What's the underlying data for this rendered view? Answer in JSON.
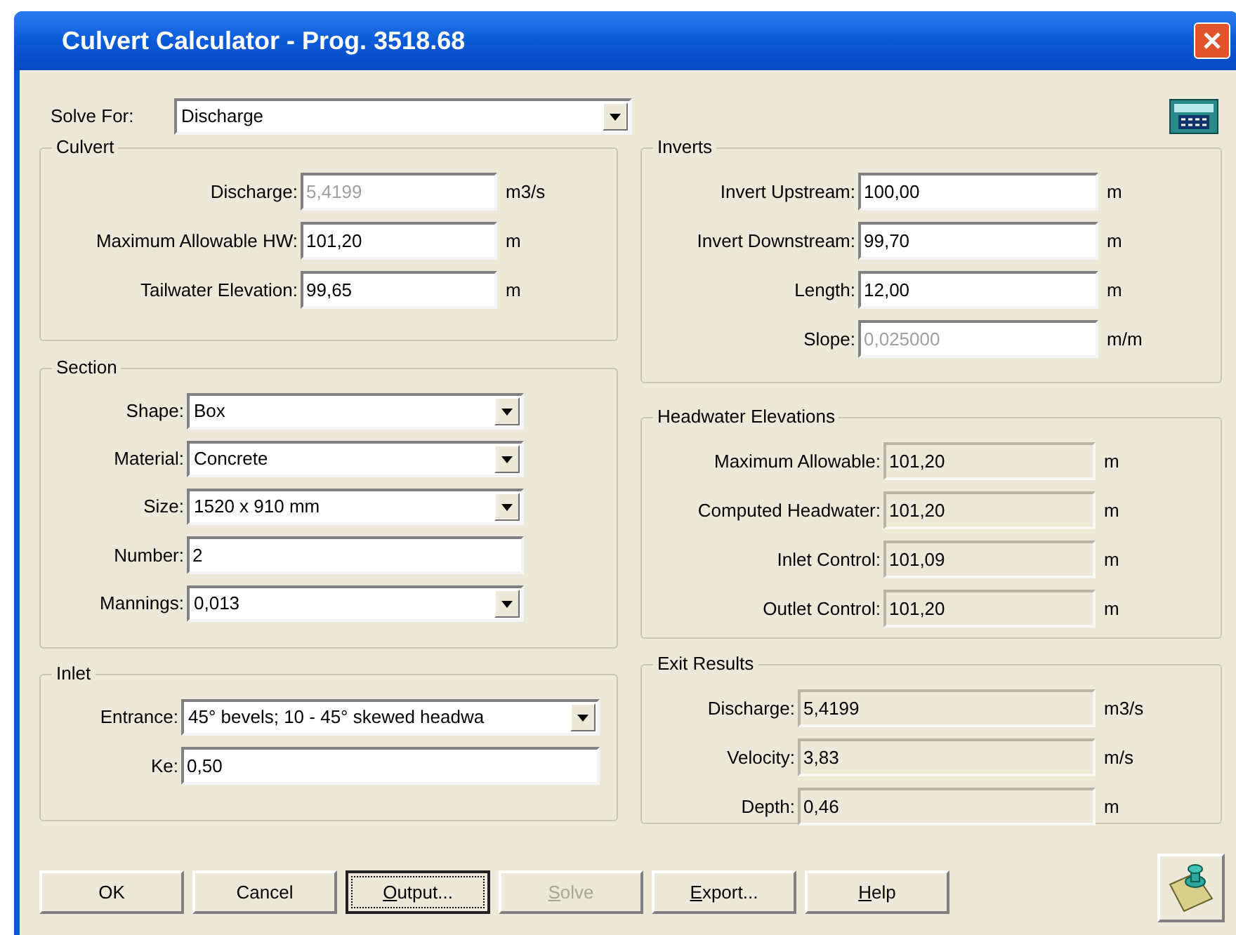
{
  "window": {
    "title": "Culvert Calculator - Prog. 3518.68"
  },
  "solve_for": {
    "label": "Solve For:",
    "value": "Discharge"
  },
  "left_groups": [
    {
      "title": "Culvert",
      "rows": [
        {
          "label": "Discharge:",
          "kind": "input",
          "value": "5,4199",
          "disabled": true,
          "unit": "m3/s"
        },
        {
          "label": "Maximum Allowable HW:",
          "kind": "input",
          "value": "101,20",
          "disabled": false,
          "unit": "m"
        },
        {
          "label": "Tailwater Elevation:",
          "kind": "input",
          "value": "99,65",
          "disabled": false,
          "unit": "m"
        }
      ]
    },
    {
      "title": "Section",
      "rows": [
        {
          "label": "Shape:",
          "kind": "dropdown",
          "value": "Box"
        },
        {
          "label": "Material:",
          "kind": "dropdown",
          "value": "Concrete"
        },
        {
          "label": "Size:",
          "kind": "dropdown",
          "value": "1520 x 910 mm"
        },
        {
          "label": "Number:",
          "kind": "input",
          "value": "2",
          "disabled": false
        },
        {
          "label": "Mannings:",
          "kind": "dropdown",
          "value": "0,013"
        }
      ]
    },
    {
      "title": "Inlet",
      "rows": [
        {
          "label": "Entrance:",
          "kind": "dropdown",
          "value": "45° bevels;  10 - 45° skewed headwa"
        },
        {
          "label": "Ke:",
          "kind": "input",
          "value": "0,50",
          "disabled": false
        }
      ]
    }
  ],
  "right_groups": [
    {
      "title": "Inverts",
      "rows": [
        {
          "label": "Invert Upstream:",
          "kind": "input",
          "value": "100,00",
          "disabled": false,
          "unit": "m"
        },
        {
          "label": "Invert Downstream:",
          "kind": "input",
          "value": "99,70",
          "disabled": false,
          "unit": "m"
        },
        {
          "label": "Length:",
          "kind": "input",
          "value": "12,00",
          "disabled": false,
          "unit": "m"
        },
        {
          "label": "Slope:",
          "kind": "input",
          "value": "0,025000",
          "disabled": true,
          "unit": "m/m"
        }
      ]
    },
    {
      "title": "Headwater Elevations",
      "rows": [
        {
          "label": "Maximum Allowable:",
          "kind": "readout",
          "value": "101,20",
          "unit": "m"
        },
        {
          "label": "Computed Headwater:",
          "kind": "readout",
          "value": "101,20",
          "unit": "m"
        },
        {
          "label": "Inlet Control:",
          "kind": "readout",
          "value": "101,09",
          "unit": "m"
        },
        {
          "label": "Outlet Control:",
          "kind": "readout",
          "value": "101,20",
          "unit": "m"
        }
      ]
    },
    {
      "title": "Exit Results",
      "rows": [
        {
          "label": "Discharge:",
          "kind": "readout",
          "value": "5,4199",
          "unit": "m3/s"
        },
        {
          "label": "Velocity:",
          "kind": "readout",
          "value": "3,83",
          "unit": "m/s"
        },
        {
          "label": "Depth:",
          "kind": "readout",
          "value": "0,46",
          "unit": "m"
        }
      ]
    }
  ],
  "buttons": [
    {
      "label": "OK",
      "underline_first": false,
      "focused": false,
      "disabled": false
    },
    {
      "label": "Cancel",
      "underline_first": false,
      "focused": false,
      "disabled": false
    },
    {
      "label": "Output...",
      "underline_first": true,
      "focused": true,
      "disabled": false
    },
    {
      "label": "Solve",
      "underline_first": true,
      "focused": false,
      "disabled": true
    },
    {
      "label": "Export...",
      "underline_first": true,
      "focused": false,
      "disabled": false
    },
    {
      "label": "Help",
      "underline_first": true,
      "focused": false,
      "disabled": false
    }
  ]
}
